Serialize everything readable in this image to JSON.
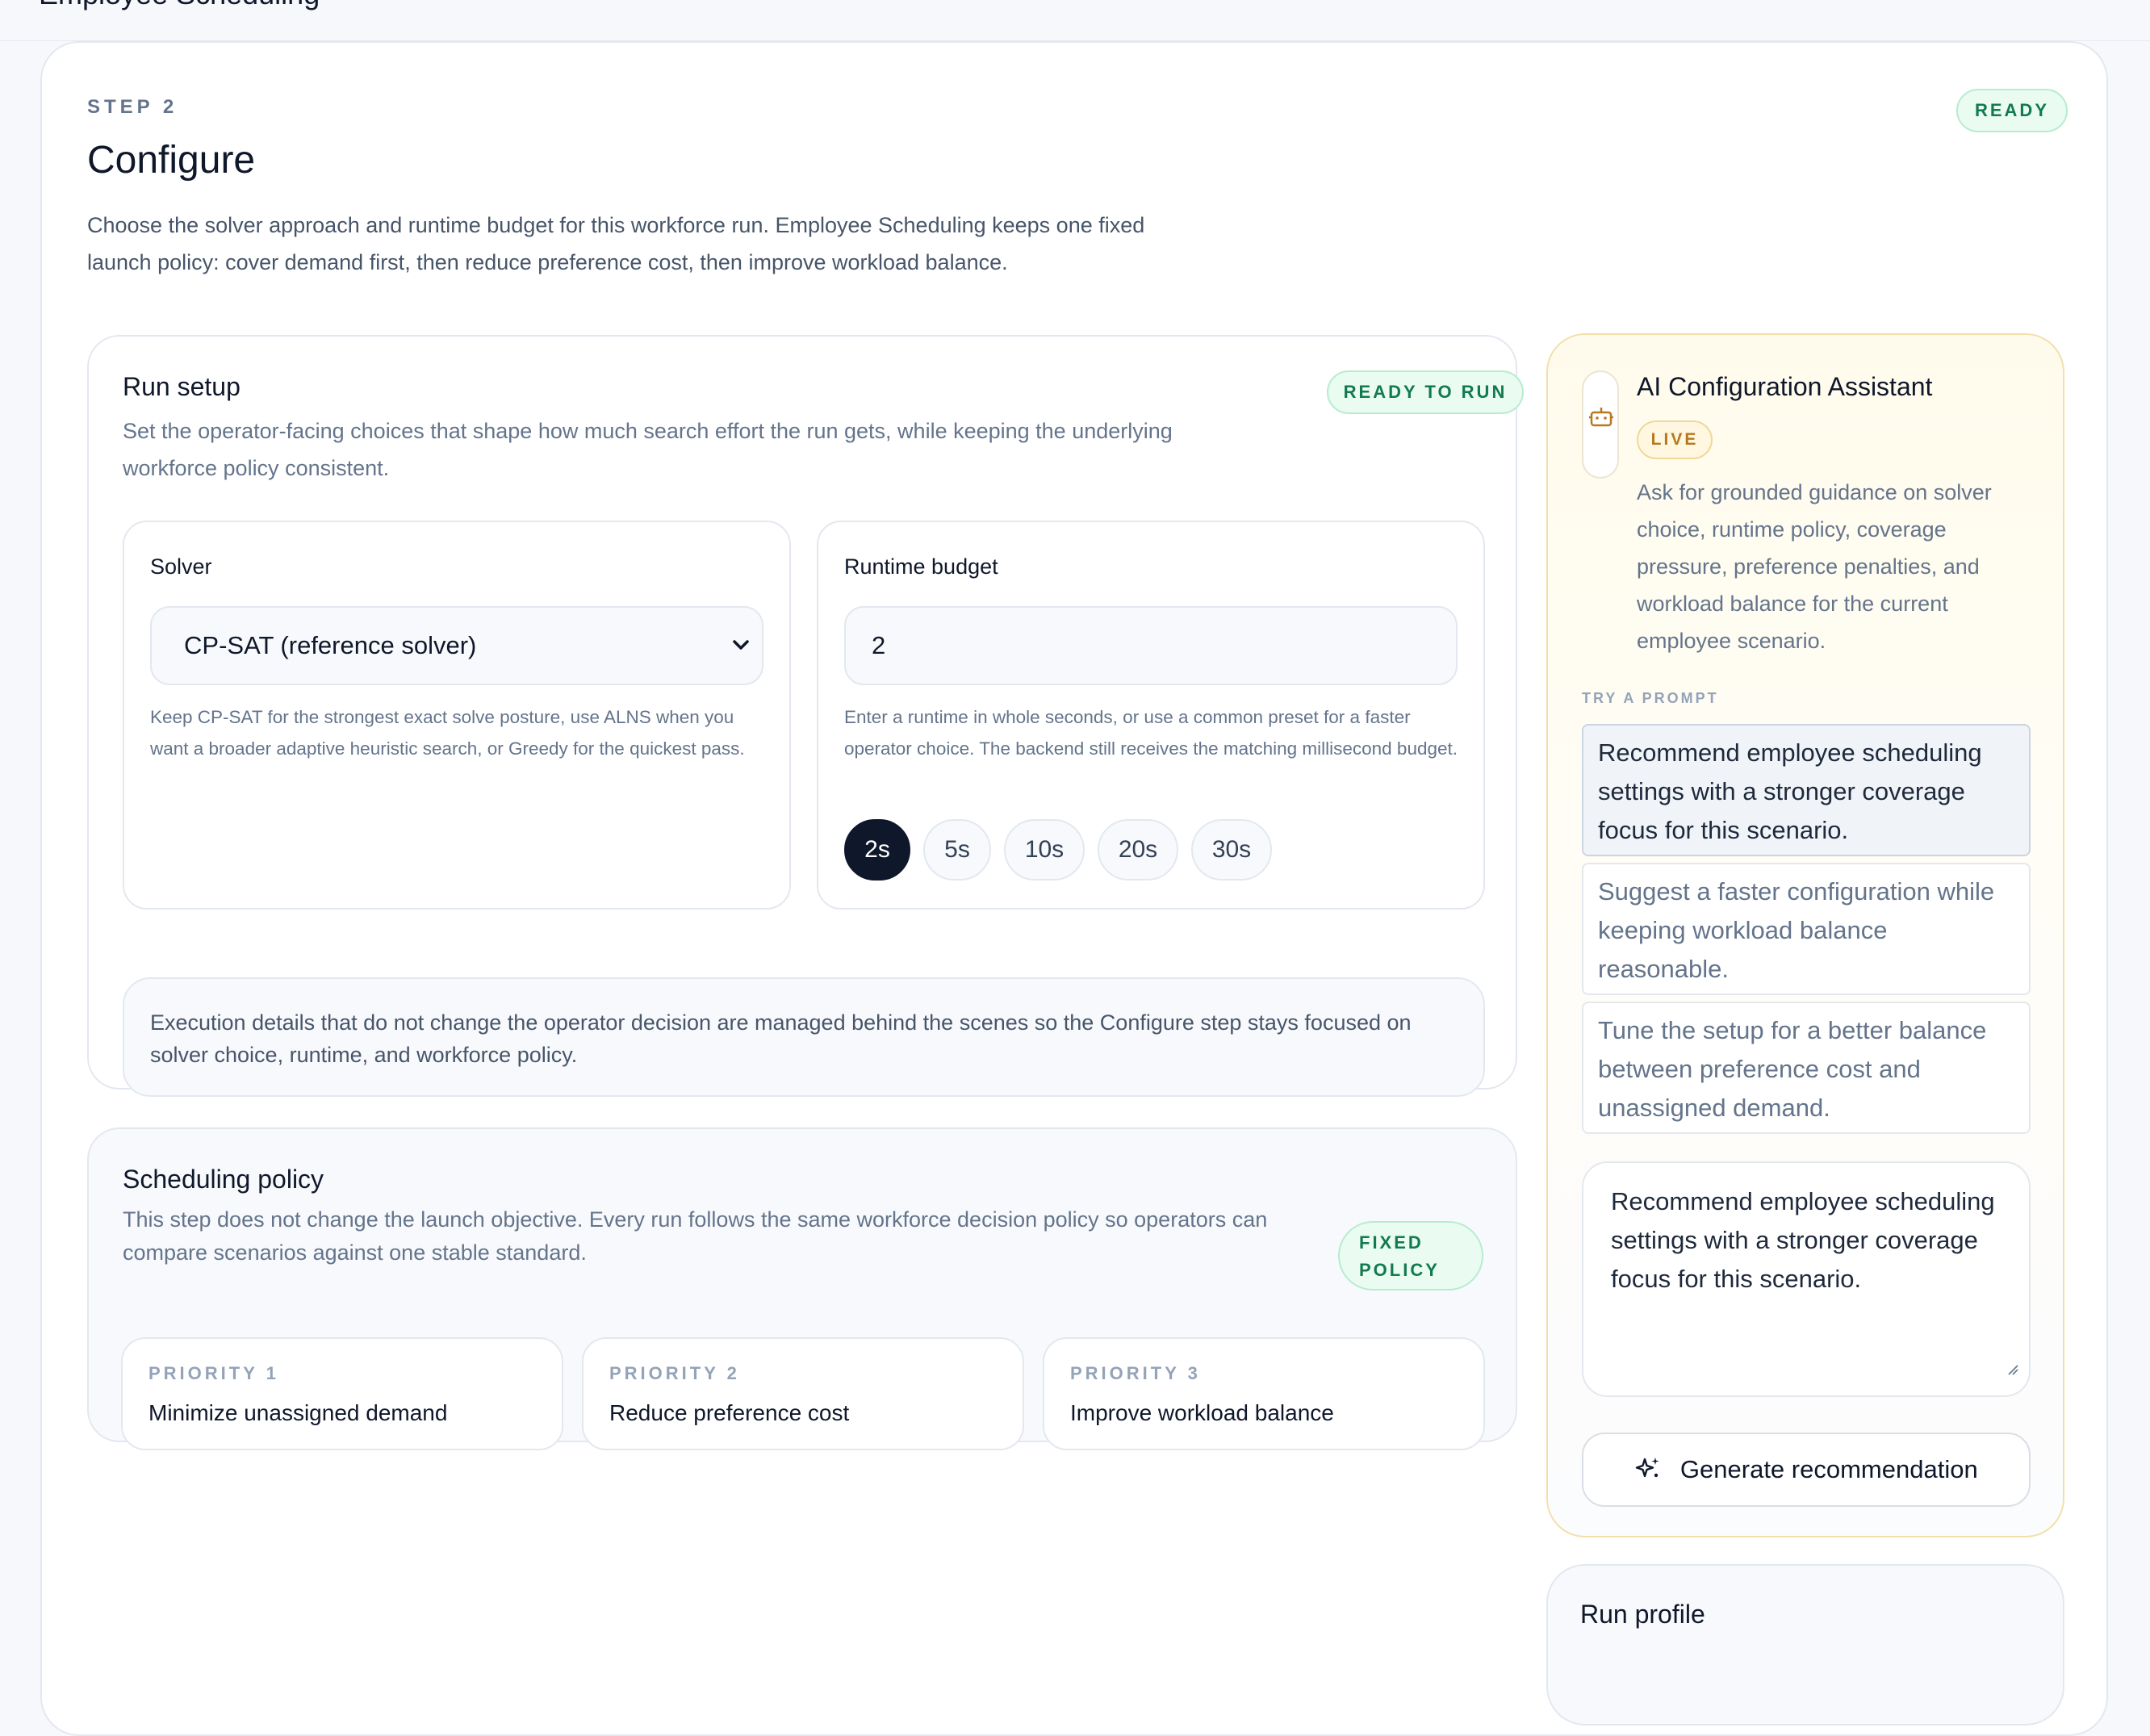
{
  "app": {
    "title": "Employee Scheduling"
  },
  "header": {
    "step_label": "STEP 2",
    "title": "Configure",
    "status": "READY",
    "description": "Choose the solver approach and runtime budget for this workforce run. Employee Scheduling keeps one fixed launch policy: cover demand first, then reduce preference cost, then improve workload balance."
  },
  "run_setup": {
    "title": "Run setup",
    "status": "READY TO RUN",
    "description": "Set the operator-facing choices that shape how much search effort the run gets, while keeping the underlying workforce policy consistent.",
    "solver": {
      "label": "Solver",
      "selected": "CP-SAT (reference solver)",
      "help": "Keep CP-SAT for the strongest exact solve posture, use ALNS when you want a broader adaptive heuristic search, or Greedy for the quickest pass."
    },
    "runtime": {
      "label": "Runtime budget",
      "value": "2",
      "help": "Enter a runtime in whole seconds, or use a common preset for a faster operator choice. The backend still receives the matching millisecond budget.",
      "presets": [
        "2s",
        "5s",
        "10s",
        "20s",
        "30s"
      ],
      "active_preset": "2s"
    },
    "execution_note": "Execution details that do not change the operator decision are managed behind the scenes so the Configure step stays focused on solver choice, runtime, and workforce policy."
  },
  "scheduling_policy": {
    "title": "Scheduling policy",
    "status_line1": "FIXED",
    "status_line2": "POLICY",
    "description": "This step does not change the launch objective. Every run follows the same workforce decision policy so operators can compare scenarios against one stable standard.",
    "priorities": [
      {
        "label": "PRIORITY 1",
        "value": "Minimize unassigned demand"
      },
      {
        "label": "PRIORITY 2",
        "value": "Reduce preference cost"
      },
      {
        "label": "PRIORITY 3",
        "value": "Improve workload balance"
      }
    ]
  },
  "assistant": {
    "title": "AI Configuration Assistant",
    "badge": "LIVE",
    "description": "Ask for grounded guidance on solver choice, runtime policy, coverage pressure, preference penalties, and workload balance for the current employee scenario.",
    "try_label": "TRY A PROMPT",
    "prompts": [
      "Recommend employee scheduling settings with a stronger coverage focus for this scenario.",
      "Suggest a faster configuration while keeping workload balance reasonable.",
      "Tune the setup for a better balance between preference cost and unassigned demand."
    ],
    "input_value": "Recommend employee scheduling settings with a stronger coverage focus for this scenario.",
    "generate_label": "Generate recommendation",
    "icon": "bot-icon",
    "accent": "#b7791f"
  },
  "run_profile": {
    "title": "Run profile"
  },
  "colors": {
    "primary_dark": "#0f172a",
    "success_bg": "#eafbf2",
    "success_text": "#127a4f",
    "warning_text": "#b7791f"
  }
}
